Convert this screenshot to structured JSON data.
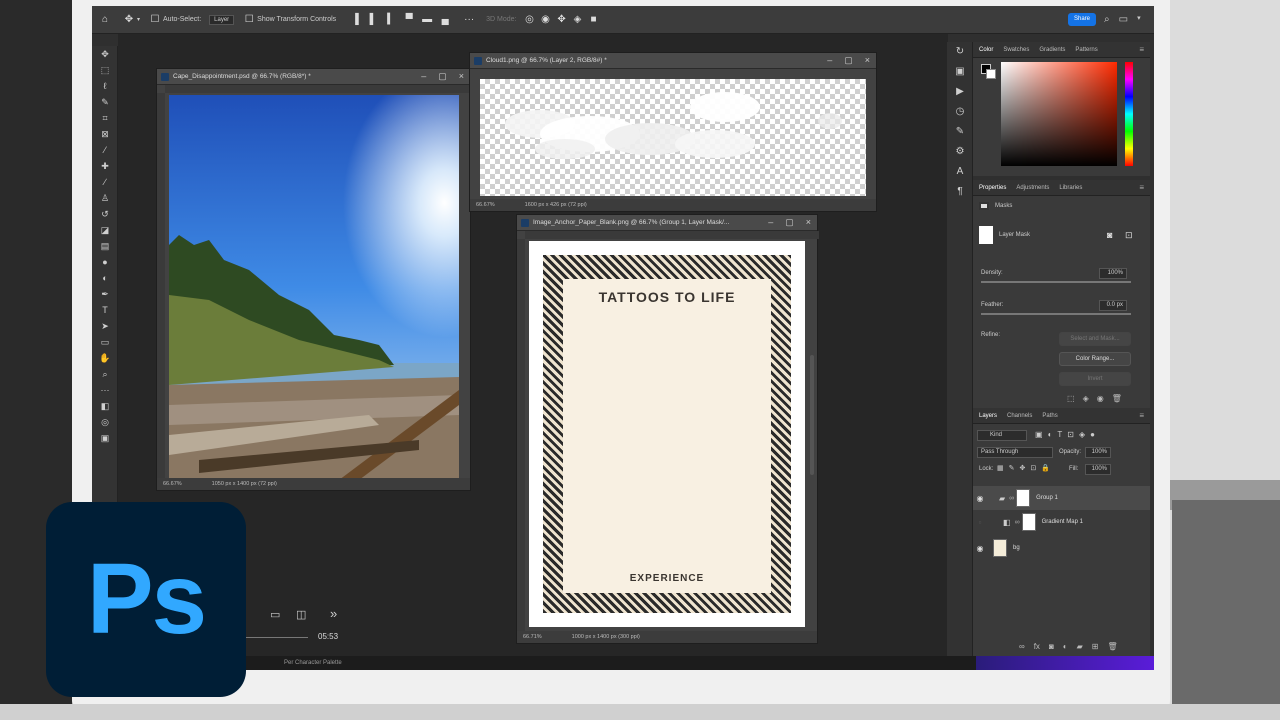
{
  "options_bar": {
    "auto_select_label": "Auto-Select:",
    "auto_select_value": "Layer",
    "transform_label": "Show Transform Controls",
    "mode_3d": "3D Mode:",
    "share_label": "Share"
  },
  "docs": {
    "cape": {
      "title": "Cape_Disappointment.psd @ 66.7% (RGB/8*) *",
      "zoom": "66.67%",
      "size": "1050 px x 1400 px (72 ppi)"
    },
    "cloud": {
      "title": "Cloud1.png @ 66.7% (Layer 2, RGB/8#) *",
      "zoom": "66.67%",
      "size": "1600 px x 426 px (72 ppi)"
    },
    "anchor": {
      "title": "Image_Anchor_Paper_Blank.png @ 66.7% (Group 1, Layer Mask/...",
      "zoom": "66.71%",
      "size": "1000 px x 1400 px (300 ppi)",
      "headline": "TATTOOS TO LIFE",
      "footer": "EXPERIENCE"
    }
  },
  "color_panel": {
    "tabs": [
      "Color",
      "Swatches",
      "Gradients",
      "Patterns"
    ]
  },
  "properties_panel": {
    "tabs": [
      "Properties",
      "Adjustments",
      "Libraries"
    ],
    "section": "Masks",
    "layer_mask": "Layer Mask",
    "density_label": "Density:",
    "density_value": "100%",
    "feather_label": "Feather:",
    "feather_value": "0.0 px",
    "refine_label": "Refine:",
    "select_and_mask": "Select and Mask...",
    "color_range": "Color Range...",
    "invert": "Invert"
  },
  "layers_panel": {
    "tabs": [
      "Layers",
      "Channels",
      "Paths"
    ],
    "kind": "Kind",
    "blend_mode": "Pass Through",
    "opacity_label": "Opacity:",
    "opacity_value": "100%",
    "lock_label": "Lock:",
    "fill_label": "Fill:",
    "fill_value": "100%",
    "layers": [
      {
        "name": "Group 1",
        "visible": true,
        "selected": true
      },
      {
        "name": "Gradient Map 1",
        "visible": false,
        "selected": false
      },
      {
        "name": "bg",
        "visible": true,
        "selected": false
      }
    ]
  },
  "video": {
    "time": "05:53"
  },
  "bottom": {
    "label": "Per Character Palette"
  },
  "logo": {
    "text": "Ps"
  },
  "colors": {
    "accent": "#1473e6",
    "ps_blue": "#31a8ff",
    "ps_navy": "#001e36"
  }
}
